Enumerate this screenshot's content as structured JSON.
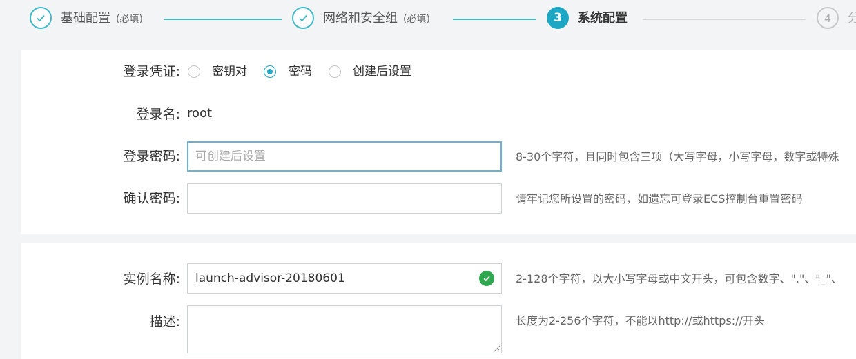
{
  "stepper": {
    "steps": [
      {
        "label": "基础配置",
        "note": "(必填)",
        "state": "done"
      },
      {
        "label": "网络和安全组",
        "note": "(必填)",
        "state": "done"
      },
      {
        "label": "系统配置",
        "number": "3",
        "state": "active"
      },
      {
        "label": "分",
        "number": "4",
        "state": "todo"
      }
    ]
  },
  "login": {
    "credential_label": "登录凭证:",
    "options": [
      {
        "label": "密钥对",
        "checked": false
      },
      {
        "label": "密码",
        "checked": true
      },
      {
        "label": "创建后设置",
        "checked": false
      }
    ],
    "username_label": "登录名:",
    "username_value": "root",
    "password_label": "登录密码:",
    "password_placeholder": "可创建后设置",
    "password_hint": "8-30个字符，且同时包含三项（大写字母，小写字母，数字或特殊",
    "confirm_label": "确认密码:",
    "confirm_hint": "请牢记您所设置的密码，如遗忘可登录ECS控制台重置密码"
  },
  "instance": {
    "name_label": "实例名称:",
    "name_value": "launch-advisor-20180601",
    "name_hint": "2-128个字符，以大小写字母或中文开头，可包含数字、\".\"、\"_\"、",
    "desc_label": "描述:",
    "desc_value": "",
    "desc_hint": "长度为2-256个字符，不能以http://或https://开头"
  },
  "colors": {
    "accent": "#1ea7c4",
    "done": "#3fb8c8",
    "success": "#2fa84f",
    "focus_border": "#6ab2d6"
  }
}
